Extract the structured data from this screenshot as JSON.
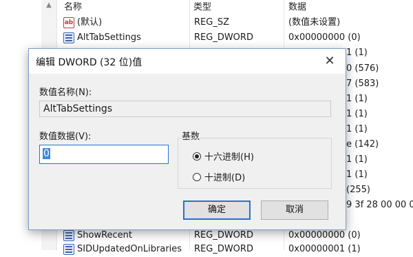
{
  "registry": {
    "columns": {
      "name": "名称",
      "type": "类型",
      "data": "数据"
    },
    "rows": [
      {
        "icon": "string-value-icon",
        "name": "(默认)",
        "type": "REG_SZ",
        "data": "(数值未设置)"
      },
      {
        "icon": "binary-value-icon",
        "name": "AltTabSettings",
        "type": "REG_DWORD",
        "data": "0x00000000 (0)"
      }
    ],
    "bottom_rows": [
      {
        "icon": "binary-value-icon",
        "name": "ShowRecent",
        "type": "REG_DWORD",
        "data": "0x00000000 (0)"
      },
      {
        "icon": "binary-value-icon",
        "name": "SIDUpdatedOnLibraries",
        "type": "REG_DWORD",
        "data": "0x00000001 (1)"
      }
    ],
    "peek": [
      "1 (1)",
      "0 (576)",
      "7 (583)",
      "1 (1)",
      "1 (1)",
      "1 (1)",
      "e (142)",
      "1 (1)",
      "1 (1)",
      "(255)",
      "9 3f 28 00 00 00 0"
    ]
  },
  "dialog": {
    "title": "编辑 DWORD (32 位)值",
    "value_name_label": "数值名称(N):",
    "value_name": "AltTabSettings",
    "value_data_label": "数值数据(V):",
    "value_data": "0",
    "base_label": "基数",
    "radio_hex": "十六进制(H)",
    "radio_dec": "十进制(D)",
    "ok_label": "确定",
    "cancel_label": "取消"
  }
}
